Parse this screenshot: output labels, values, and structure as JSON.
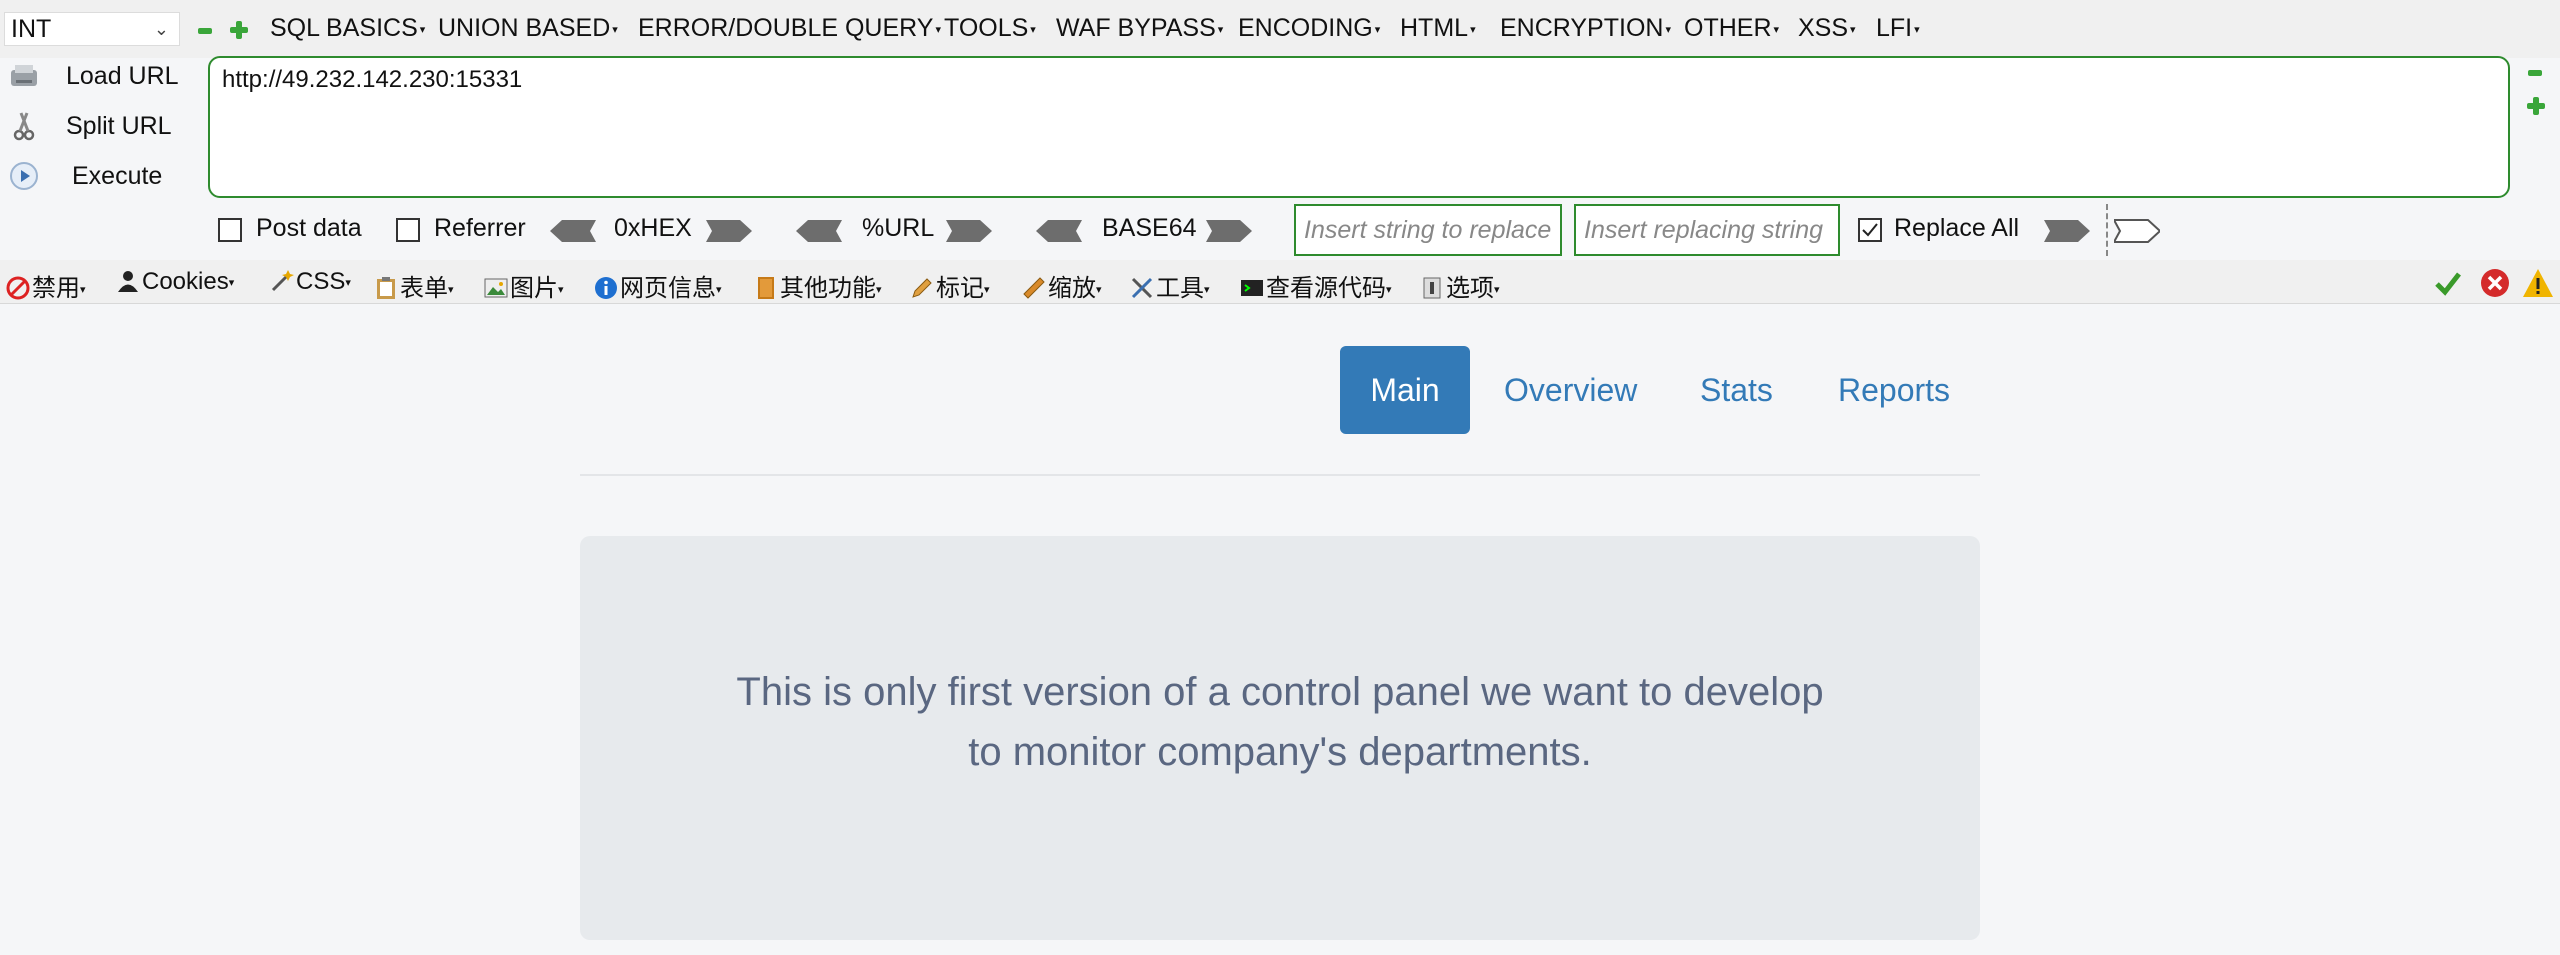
{
  "hackbar": {
    "type_select": "INT",
    "menu": [
      "SQL BASICS",
      "UNION BASED",
      "ERROR/DOUBLE QUERY",
      "TOOLS",
      "WAF BYPASS",
      "ENCODING",
      "HTML",
      "ENCRYPTION",
      "OTHER",
      "XSS",
      "LFI"
    ],
    "actions": {
      "load": "Load URL",
      "split": "Split URL",
      "execute": "Execute"
    },
    "url": "http://49.232.142.230:15331",
    "post_data_label": "Post data",
    "referrer_label": "Referrer",
    "hex_label": "0xHEX",
    "url_enc_label": "%URL",
    "base64_label": "BASE64",
    "find_placeholder": "Insert string to replace",
    "replace_placeholder": "Insert replacing string",
    "replace_all_label": "Replace All"
  },
  "firebug": {
    "items": [
      "禁用",
      "Cookies",
      "CSS",
      "表单",
      "图片",
      "网页信息",
      "其他功能",
      "标记",
      "缩放",
      "工具",
      "查看源代码",
      "选项"
    ]
  },
  "page": {
    "nav": [
      "Main",
      "Overview",
      "Stats",
      "Reports"
    ],
    "jumbo_line1": "This is only first version of a control panel we want to develop",
    "jumbo_line2": "to monitor company's departments."
  },
  "colors": {
    "accent": "#337ab7",
    "green_border": "#2e8b2e",
    "jumbo_text": "#5a6781"
  }
}
